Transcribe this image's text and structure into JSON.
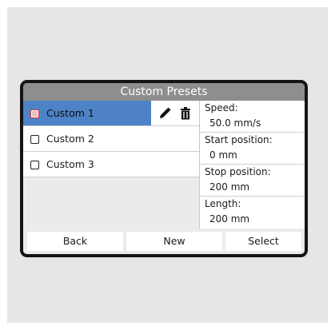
{
  "title": "Custom Presets",
  "presets": [
    {
      "label": "Custom 1",
      "selected": true
    },
    {
      "label": "Custom 2",
      "selected": false
    },
    {
      "label": "Custom 3",
      "selected": false
    }
  ],
  "icons": {
    "edit": "pencil-icon",
    "delete": "trash-icon"
  },
  "details": [
    {
      "key": "Speed:",
      "value": "50.0 mm/s"
    },
    {
      "key": "Start position:",
      "value": "0 mm"
    },
    {
      "key": "Stop position:",
      "value": "200 mm"
    },
    {
      "key": "Length:",
      "value": "200 mm"
    }
  ],
  "buttons": {
    "back": "Back",
    "new": "New",
    "select": "Select"
  },
  "colors": {
    "selected_row": "#4d82c7",
    "title_bar": "#8e8e8e",
    "checkbox_selected": "#d23b3b"
  }
}
